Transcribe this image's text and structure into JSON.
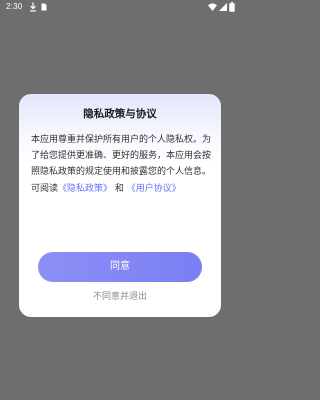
{
  "status_bar": {
    "time": "2:30",
    "icons": [
      "download-icon",
      "sim-card-icon",
      "wifi-icon",
      "cellular-signal-icon",
      "battery-icon"
    ]
  },
  "dialog": {
    "title": "隐私政策与协议",
    "body_prefix": "本应用尊重并保护所有用户的个人隐私权。为了给您提供更准确、更好的服务，本应用会按照隐私政策的规定使用和披露您的个人信息。可阅读",
    "privacy_link": "《隐私政策》",
    "conjunction": "和",
    "user_agreement_link": "《用户协议》",
    "agree_label": "同意",
    "decline_label": "不同意并退出"
  },
  "colors": {
    "overlay": "#6e6e6e",
    "accent": "#7b7ef3",
    "link": "#6b72f5",
    "muted_text": "#8a8a8a"
  }
}
